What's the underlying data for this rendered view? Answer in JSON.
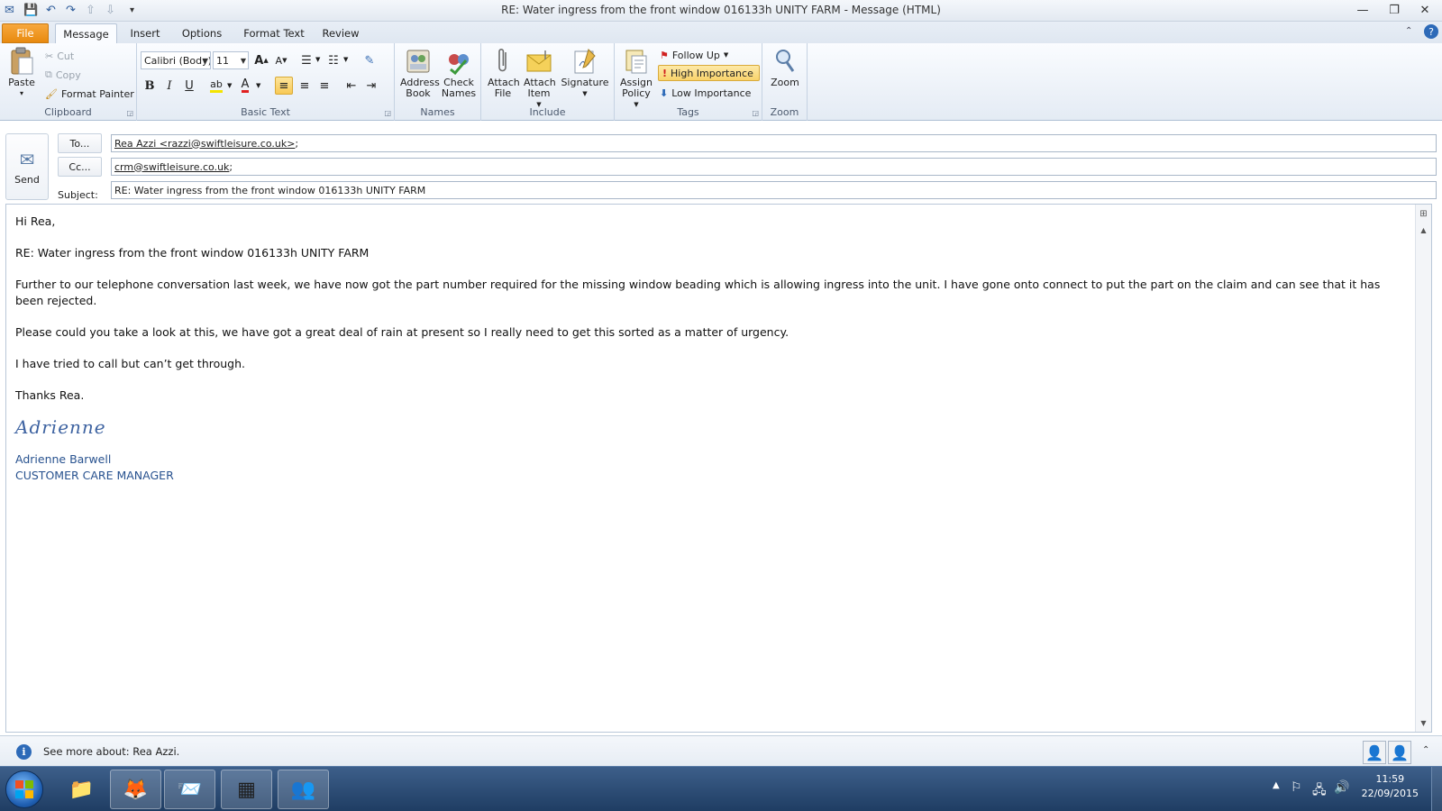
{
  "window": {
    "title": "RE: Water ingress from the front window 016133h UNITY FARM  -  Message (HTML)"
  },
  "tabs": [
    {
      "label": "File"
    },
    {
      "label": "Message"
    },
    {
      "label": "Insert"
    },
    {
      "label": "Options"
    },
    {
      "label": "Format Text"
    },
    {
      "label": "Review"
    }
  ],
  "ribbon": {
    "clipboard": {
      "label": "Clipboard",
      "paste": "Paste",
      "cut": "Cut",
      "copy": "Copy",
      "format_painter": "Format Painter"
    },
    "basic_text": {
      "label": "Basic Text",
      "font_name": "Calibri (Body)",
      "font_size": "11"
    },
    "names": {
      "label": "Names",
      "address_book": "Address Book",
      "check_names": "Check Names"
    },
    "include": {
      "label": "Include",
      "attach_file": "Attach File",
      "attach_item": "Attach Item",
      "signature": "Signature"
    },
    "tags": {
      "label": "Tags",
      "assign_policy": "Assign Policy",
      "follow_up": "Follow Up",
      "high_importance": "High Importance",
      "low_importance": "Low Importance"
    },
    "zoom": {
      "label": "Zoom",
      "zoom": "Zoom"
    }
  },
  "header": {
    "send": "Send",
    "to_button": "To...",
    "cc_button": "Cc...",
    "subject_label": "Subject:",
    "to_value": "Rea Azzi <razzi@swiftleisure.co.uk>",
    "to_sep": ";",
    "cc_value": "crm@swiftleisure.co.uk",
    "cc_sep": ";",
    "subject_value": "RE: Water ingress from the front window 016133h UNITY FARM"
  },
  "body": {
    "greeting": "Hi Rea,",
    "ref_line": "RE: Water ingress from the front window 016133h UNITY FARM",
    "para1": "Further to our telephone conversation last week, we have now got the part number required for the missing window beading which is allowing ingress into the unit.  I have gone onto connect to put the part on the claim and can see that it has been rejected.",
    "para2": "Please could you take a look at this, we have got a great deal of rain at present so I really need to get this sorted as a matter of urgency.",
    "para3": "I have tried to call but can’t get through.",
    "thanks": "Thanks Rea.",
    "signature_script": "Adrienne",
    "signature_name": "Adrienne Barwell",
    "signature_title": "CUSTOMER CARE MANAGER"
  },
  "people_pane": {
    "see_more": "See more about: Rea Azzi."
  },
  "taskbar": {
    "time": "11:59",
    "date": "22/09/2015"
  },
  "colors": {
    "file_tab": "#e88a0f",
    "ribbon_highlight": "#f8c955",
    "signature_blue": "#28528f",
    "taskbar": "#1f3d63"
  }
}
